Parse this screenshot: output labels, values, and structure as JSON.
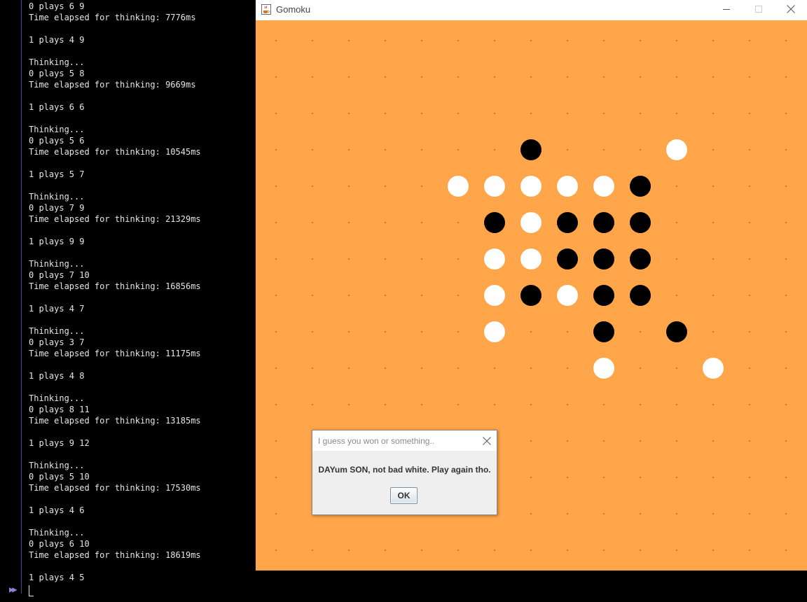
{
  "terminal": {
    "lines": [
      "0 plays 6 9",
      "Time elapsed for thinking: 7776ms",
      "",
      "1 plays 4 9",
      "",
      "Thinking...",
      "0 plays 5 8",
      "Time elapsed for thinking: 9669ms",
      "",
      "1 plays 6 6",
      "",
      "Thinking...",
      "0 plays 5 6",
      "Time elapsed for thinking: 10545ms",
      "",
      "1 plays 5 7",
      "",
      "Thinking...",
      "0 plays 7 9",
      "Time elapsed for thinking: 21329ms",
      "",
      "1 plays 9 9",
      "",
      "Thinking...",
      "0 plays 7 10",
      "Time elapsed for thinking: 16856ms",
      "",
      "1 plays 4 7",
      "",
      "Thinking...",
      "0 plays 3 7",
      "Time elapsed for thinking: 11175ms",
      "",
      "1 plays 4 8",
      "",
      "Thinking...",
      "0 plays 8 11",
      "Time elapsed for thinking: 13185ms",
      "",
      "1 plays 9 12",
      "",
      "Thinking...",
      "0 plays 5 10",
      "Time elapsed for thinking: 17530ms",
      "",
      "1 plays 4 6",
      "",
      "Thinking...",
      "0 plays 6 10",
      "Time elapsed for thinking: 18619ms",
      "",
      "1 plays 4 5"
    ],
    "prompt_icon": "fast-forward-icon",
    "text_color": "#e6e6e6"
  },
  "window": {
    "title": "Gomoku",
    "app_icon": "java-cup-icon",
    "controls": [
      "minimize-icon",
      "maximize-icon",
      "close-icon"
    ]
  },
  "board": {
    "size": 15,
    "background_color": "#ffa54a",
    "grid_dot_color": "#a0581a",
    "stones": [
      {
        "row": 3,
        "col": 7,
        "color": "black"
      },
      {
        "row": 3,
        "col": 11,
        "color": "white"
      },
      {
        "row": 4,
        "col": 5,
        "color": "white"
      },
      {
        "row": 4,
        "col": 6,
        "color": "white"
      },
      {
        "row": 4,
        "col": 7,
        "color": "white"
      },
      {
        "row": 4,
        "col": 8,
        "color": "white"
      },
      {
        "row": 4,
        "col": 9,
        "color": "white"
      },
      {
        "row": 4,
        "col": 10,
        "color": "black"
      },
      {
        "row": 5,
        "col": 6,
        "color": "black"
      },
      {
        "row": 5,
        "col": 7,
        "color": "white"
      },
      {
        "row": 5,
        "col": 8,
        "color": "black"
      },
      {
        "row": 5,
        "col": 9,
        "color": "black"
      },
      {
        "row": 5,
        "col": 10,
        "color": "black"
      },
      {
        "row": 6,
        "col": 6,
        "color": "white"
      },
      {
        "row": 6,
        "col": 7,
        "color": "white"
      },
      {
        "row": 6,
        "col": 8,
        "color": "black"
      },
      {
        "row": 6,
        "col": 9,
        "color": "black"
      },
      {
        "row": 6,
        "col": 10,
        "color": "black"
      },
      {
        "row": 7,
        "col": 6,
        "color": "white"
      },
      {
        "row": 7,
        "col": 7,
        "color": "black"
      },
      {
        "row": 7,
        "col": 8,
        "color": "white"
      },
      {
        "row": 7,
        "col": 9,
        "color": "black"
      },
      {
        "row": 7,
        "col": 10,
        "color": "black"
      },
      {
        "row": 8,
        "col": 6,
        "color": "white"
      },
      {
        "row": 8,
        "col": 9,
        "color": "black"
      },
      {
        "row": 8,
        "col": 11,
        "color": "black"
      },
      {
        "row": 9,
        "col": 9,
        "color": "white"
      },
      {
        "row": 9,
        "col": 12,
        "color": "white"
      }
    ]
  },
  "dialog": {
    "title": "I guess you won or something..",
    "message": "DAYum SON, not bad white. Play again tho.",
    "ok_label": "OK",
    "close_icon": "close-icon"
  }
}
